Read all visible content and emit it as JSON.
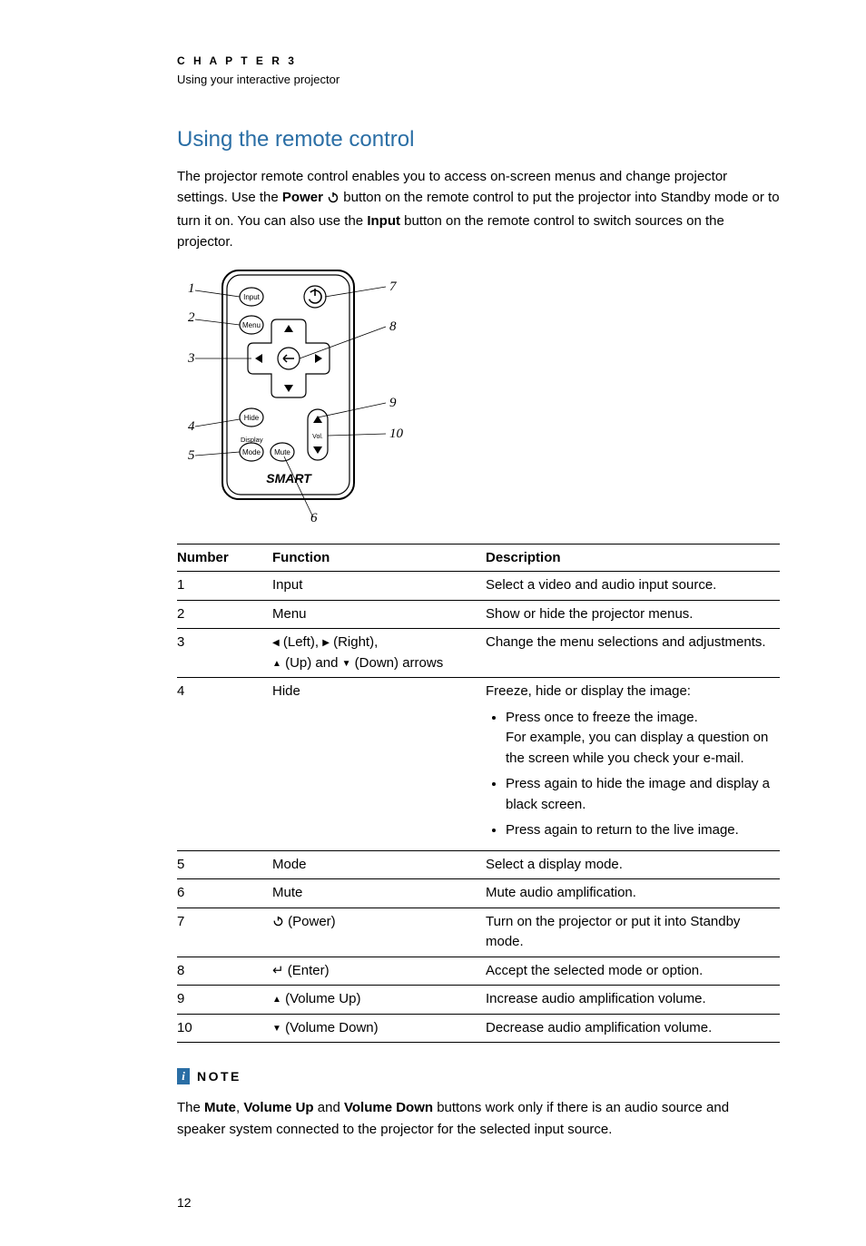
{
  "chapter": {
    "label": "C H A P T E R   3",
    "subtitle": "Using your interactive projector"
  },
  "section_title": "Using the remote control",
  "intro": {
    "p1a": "The projector remote control enables you to access on-screen menus and change projector settings. Use the ",
    "p1_power": "Power",
    "p1b": " button on the remote control to put the projector into Standby mode or to turn it on. You can also use the ",
    "p1_input": "Input",
    "p1c": " button on the remote control to switch sources on the projector."
  },
  "remote_labels": {
    "input": "Input",
    "menu": "Menu",
    "hide": "Hide",
    "display_mode": "Display\nMode",
    "mute": "Mute",
    "vol": "Vol.",
    "brand": "SMART"
  },
  "callouts": [
    "1",
    "2",
    "3",
    "4",
    "5",
    "6",
    "7",
    "8",
    "9",
    "10"
  ],
  "table": {
    "headers": [
      "Number",
      "Function",
      "Description"
    ],
    "rows": [
      {
        "num": "1",
        "fn": "Input",
        "desc": "Select a video and audio input source."
      },
      {
        "num": "2",
        "fn": "Menu",
        "desc": "Show or hide the projector menus."
      },
      {
        "num": "3",
        "fn_parts": {
          "left": " (Left), ",
          "right": " (Right),",
          "br": "",
          "up": " (Up) and ",
          "down": " (Down) arrows"
        },
        "desc": "Change the menu selections and adjustments."
      },
      {
        "num": "4",
        "fn": "Hide",
        "desc_lead": "Freeze, hide or display the image:",
        "bullets": [
          "Press once to freeze the image.\nFor example, you can display a question on the screen while you check your e-mail.",
          "Press again to hide the image and display a black screen.",
          "Press again to return to the live image."
        ]
      },
      {
        "num": "5",
        "fn": "Mode",
        "desc": "Select a display mode."
      },
      {
        "num": "6",
        "fn": "Mute",
        "desc": "Mute audio amplification."
      },
      {
        "num": "7",
        "fn_suffix": " (Power)",
        "desc": "Turn on the projector or put it into Standby mode."
      },
      {
        "num": "8",
        "fn_suffix": " (Enter)",
        "desc": "Accept the selected mode or option."
      },
      {
        "num": "9",
        "fn_suffix": " (Volume Up)",
        "desc": "Increase audio amplification volume."
      },
      {
        "num": "10",
        "fn_suffix": " (Volume Down)",
        "desc": "Decrease audio amplification volume."
      }
    ]
  },
  "note": {
    "label": "NOTE",
    "text_a": "The ",
    "b1": "Mute",
    "text_b": ", ",
    "b2": "Volume Up",
    "text_c": " and ",
    "b3": "Volume Down",
    "text_d": " buttons work only if there is an audio source and speaker system connected to the projector for the selected input source."
  },
  "page_number": "12"
}
